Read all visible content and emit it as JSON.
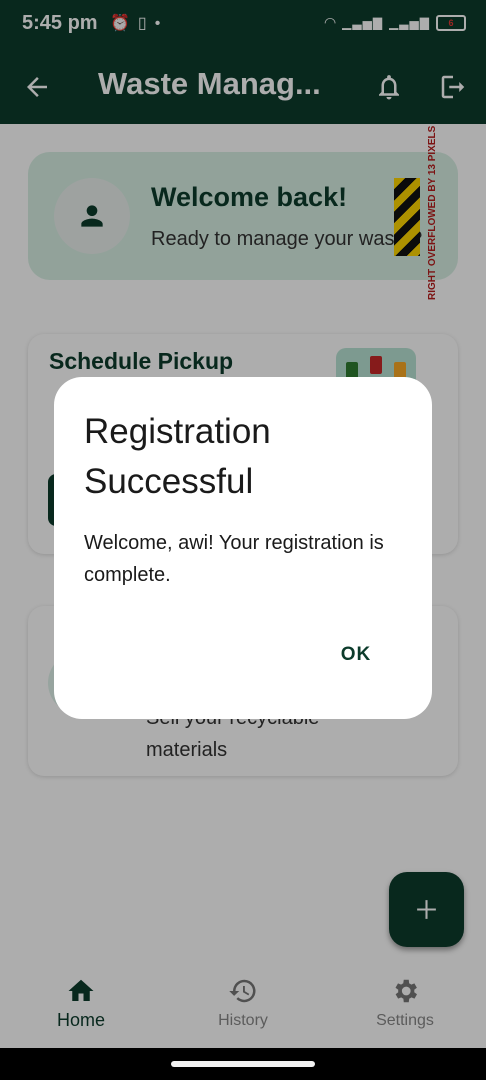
{
  "status_bar": {
    "time": "5:45 pm",
    "left_icons": [
      "alarm-icon",
      "vibrate-icon",
      "dot-icon"
    ],
    "right_icons": [
      "wifi-icon",
      "signal-icon",
      "signal-icon",
      "battery-icon"
    ],
    "battery_text": "6"
  },
  "app_bar": {
    "title": "Waste Manag...",
    "icons": [
      "back-arrow-icon",
      "bell-icon",
      "logout-icon"
    ]
  },
  "welcome_card": {
    "title": "Welcome back!",
    "subtitle": "Ready to manage your waste?",
    "overflow_warning": "RIGHT OVERFLOWED BY 13 PIXELS"
  },
  "pickup_card": {
    "title": "Schedule Pickup",
    "description": "",
    "image": "waste-bins-image"
  },
  "sell_card": {
    "description": "Sell your recyclable materials"
  },
  "fab": {
    "icon": "plus-icon"
  },
  "bottom_nav": {
    "items": [
      {
        "label": "Home",
        "icon": "home-icon",
        "active": true
      },
      {
        "label": "History",
        "icon": "history-icon",
        "active": false
      },
      {
        "label": "Settings",
        "icon": "settings-icon",
        "active": false
      }
    ]
  },
  "dialog": {
    "title": "Registration Successful",
    "message": "Welcome, awi! Your registration is complete.",
    "ok_label": "OK"
  },
  "colors": {
    "primary": "#0c3b2b",
    "welcome_card_bg": "#d7efe4",
    "overflow_text": "#b71c1c"
  }
}
